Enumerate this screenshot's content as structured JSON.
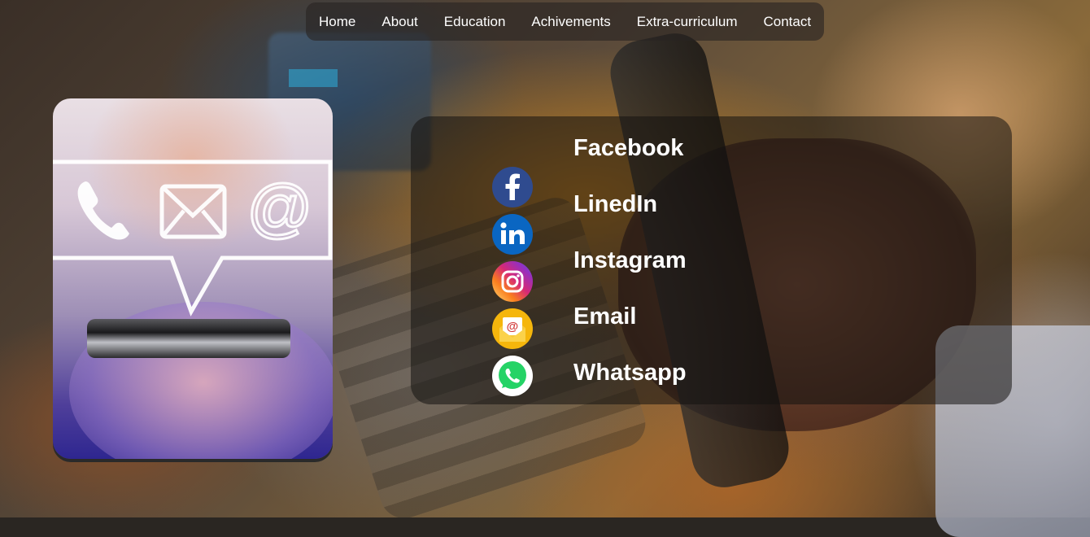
{
  "nav": {
    "items": [
      {
        "label": "Home"
      },
      {
        "label": "About"
      },
      {
        "label": "Education"
      },
      {
        "label": "Achivements"
      },
      {
        "label": "Extra-curriculum"
      },
      {
        "label": "Contact"
      }
    ]
  },
  "hero_image": {
    "icons": [
      "phone-icon",
      "mail-icon",
      "at-sign-icon"
    ],
    "at_symbol": "@"
  },
  "contacts": {
    "items": [
      {
        "label": "Facebook",
        "icon": "facebook-icon",
        "color": "#3b5998"
      },
      {
        "label": "LinedIn",
        "icon": "linkedin-icon",
        "color": "#0a66c2"
      },
      {
        "label": "Instagram",
        "icon": "instagram-icon",
        "color": "#c13584"
      },
      {
        "label": "Email",
        "icon": "email-icon",
        "color": "#f5b60c"
      },
      {
        "label": "Whatsapp",
        "icon": "whatsapp-icon",
        "color": "#25d366"
      }
    ]
  },
  "colors": {
    "nav_bg": "rgba(40,36,34,0.62)",
    "panel_bg": "rgba(20,18,16,0.55)",
    "text": "#ffffff"
  }
}
